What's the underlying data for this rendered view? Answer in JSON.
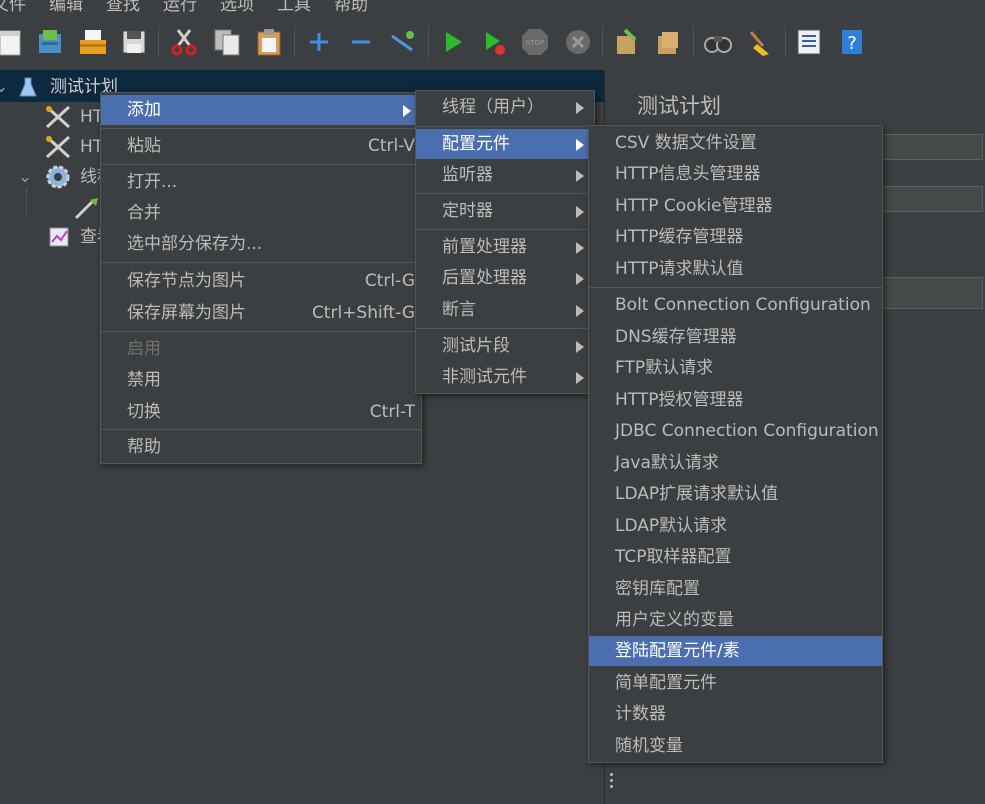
{
  "menubar": [
    "文件",
    "编辑",
    "查找",
    "运行",
    "选项",
    "工具",
    "帮助"
  ],
  "tree": {
    "items": [
      {
        "label": "测试计划",
        "icon": "flask-icon"
      },
      {
        "label": "HT",
        "icon": "tools-icon"
      },
      {
        "label": "HT",
        "icon": "tools-icon"
      },
      {
        "label": "线程",
        "icon": "gear-icon"
      },
      {
        "label": "",
        "icon": "pipette-icon"
      },
      {
        "label": "查看",
        "icon": "chart-icon"
      }
    ]
  },
  "right_panel": {
    "title": "测试计划"
  },
  "context_menu": [
    {
      "label": "添加",
      "shortcut": "",
      "submenu": true,
      "selected": true,
      "disabled": false
    },
    {
      "label": "粘贴",
      "shortcut": "Ctrl-V",
      "submenu": false,
      "selected": false,
      "disabled": false
    },
    {
      "label": "打开...",
      "shortcut": "",
      "submenu": false,
      "selected": false,
      "disabled": false
    },
    {
      "label": "合并",
      "shortcut": "",
      "submenu": false,
      "selected": false,
      "disabled": false
    },
    {
      "label": "选中部分保存为...",
      "shortcut": "",
      "submenu": false,
      "selected": false,
      "disabled": false
    },
    {
      "label": "保存节点为图片",
      "shortcut": "Ctrl-G",
      "submenu": false,
      "selected": false,
      "disabled": false
    },
    {
      "label": "保存屏幕为图片",
      "shortcut": "Ctrl+Shift-G",
      "submenu": false,
      "selected": false,
      "disabled": false
    },
    {
      "label": "启用",
      "shortcut": "",
      "submenu": false,
      "selected": false,
      "disabled": true
    },
    {
      "label": "禁用",
      "shortcut": "",
      "submenu": false,
      "selected": false,
      "disabled": false
    },
    {
      "label": "切换",
      "shortcut": "Ctrl-T",
      "submenu": false,
      "selected": false,
      "disabled": false
    },
    {
      "label": "帮助",
      "shortcut": "",
      "submenu": false,
      "selected": false,
      "disabled": false
    }
  ],
  "add_submenu": [
    {
      "label": "线程（用户）",
      "selected": false
    },
    {
      "label": "配置元件",
      "selected": true
    },
    {
      "label": "监听器",
      "selected": false
    },
    {
      "label": "定时器",
      "selected": false
    },
    {
      "label": "前置处理器",
      "selected": false
    },
    {
      "label": "后置处理器",
      "selected": false
    },
    {
      "label": "断言",
      "selected": false
    },
    {
      "label": "测试片段",
      "selected": false
    },
    {
      "label": "非测试元件",
      "selected": false
    }
  ],
  "config_submenu": [
    {
      "label": "CSV 数据文件设置",
      "selected": false
    },
    {
      "label": "HTTP信息头管理器",
      "selected": false
    },
    {
      "label": "HTTP Cookie管理器",
      "selected": false
    },
    {
      "label": "HTTP缓存管理器",
      "selected": false
    },
    {
      "label": "HTTP请求默认值",
      "selected": false
    },
    {
      "label": "Bolt Connection Configuration",
      "selected": false
    },
    {
      "label": "DNS缓存管理器",
      "selected": false
    },
    {
      "label": "FTP默认请求",
      "selected": false
    },
    {
      "label": "HTTP授权管理器",
      "selected": false
    },
    {
      "label": "JDBC Connection Configuration",
      "selected": false
    },
    {
      "label": "Java默认请求",
      "selected": false
    },
    {
      "label": "LDAP扩展请求默认值",
      "selected": false
    },
    {
      "label": "LDAP默认请求",
      "selected": false
    },
    {
      "label": "TCP取样器配置",
      "selected": false
    },
    {
      "label": "密钥库配置",
      "selected": false
    },
    {
      "label": "用户定义的变量",
      "selected": false
    },
    {
      "label": "登陆配置元件/素",
      "selected": true
    },
    {
      "label": "简单配置元件",
      "selected": false
    },
    {
      "label": "计数器",
      "selected": false
    },
    {
      "label": "随机变量",
      "selected": false
    }
  ],
  "colors": {
    "background": "#3c3f41",
    "selection": "#4b6eaf",
    "tree_selection": "#0d293e",
    "text": "#bbbbbb"
  }
}
